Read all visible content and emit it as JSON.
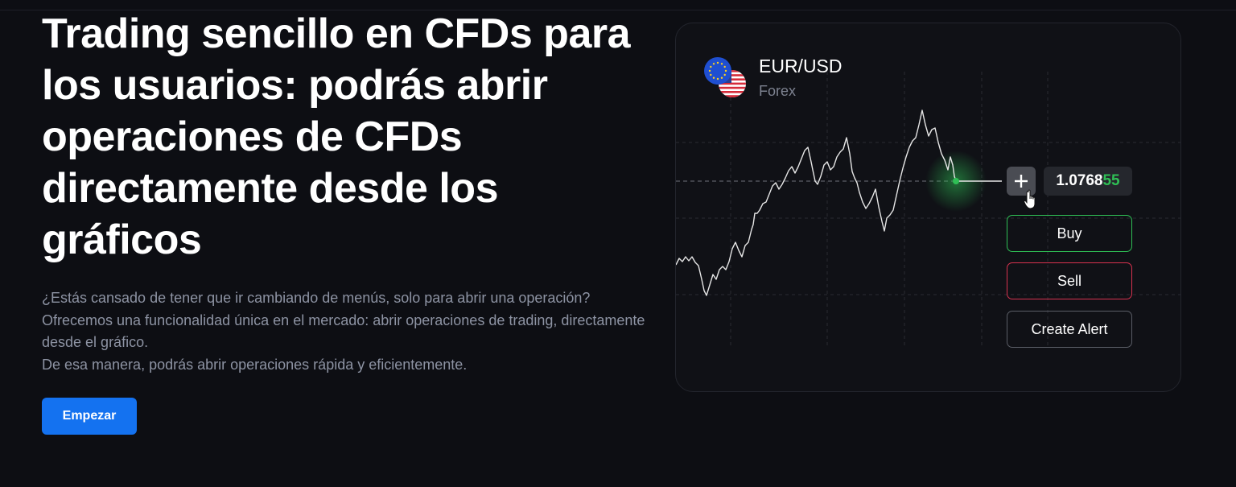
{
  "hero": {
    "title": "Trading sencillo en CFDs para los usuarios: podrás abrir operaciones de CFDs directamente desde los gráficos",
    "description_lines": [
      "¿Estás cansado de tener que ir cambiando de menús, solo para abrir una operación?",
      "Ofrecemos una funcionalidad única en el mercado: abrir operaciones de trading, directamente desde el gráfico.",
      "De esa manera, podrás abrir operaciones rápida y eficientemente."
    ],
    "cta_label": "Empezar"
  },
  "chart_card": {
    "pair": "EUR/USD",
    "market": "Forex",
    "price_main": "1.0768",
    "price_highlight": "55",
    "buy_label": "Buy",
    "sell_label": "Sell",
    "alert_label": "Create Alert",
    "icons": [
      "eu-flag-icon",
      "us-flag-icon",
      "plus-icon",
      "hand-cursor-icon"
    ]
  },
  "colors": {
    "background": "#0d0e13",
    "accent": "#1472f0",
    "buy": "#2fbf55",
    "sell": "#d8324f",
    "muted_text": "#8d93a3"
  }
}
